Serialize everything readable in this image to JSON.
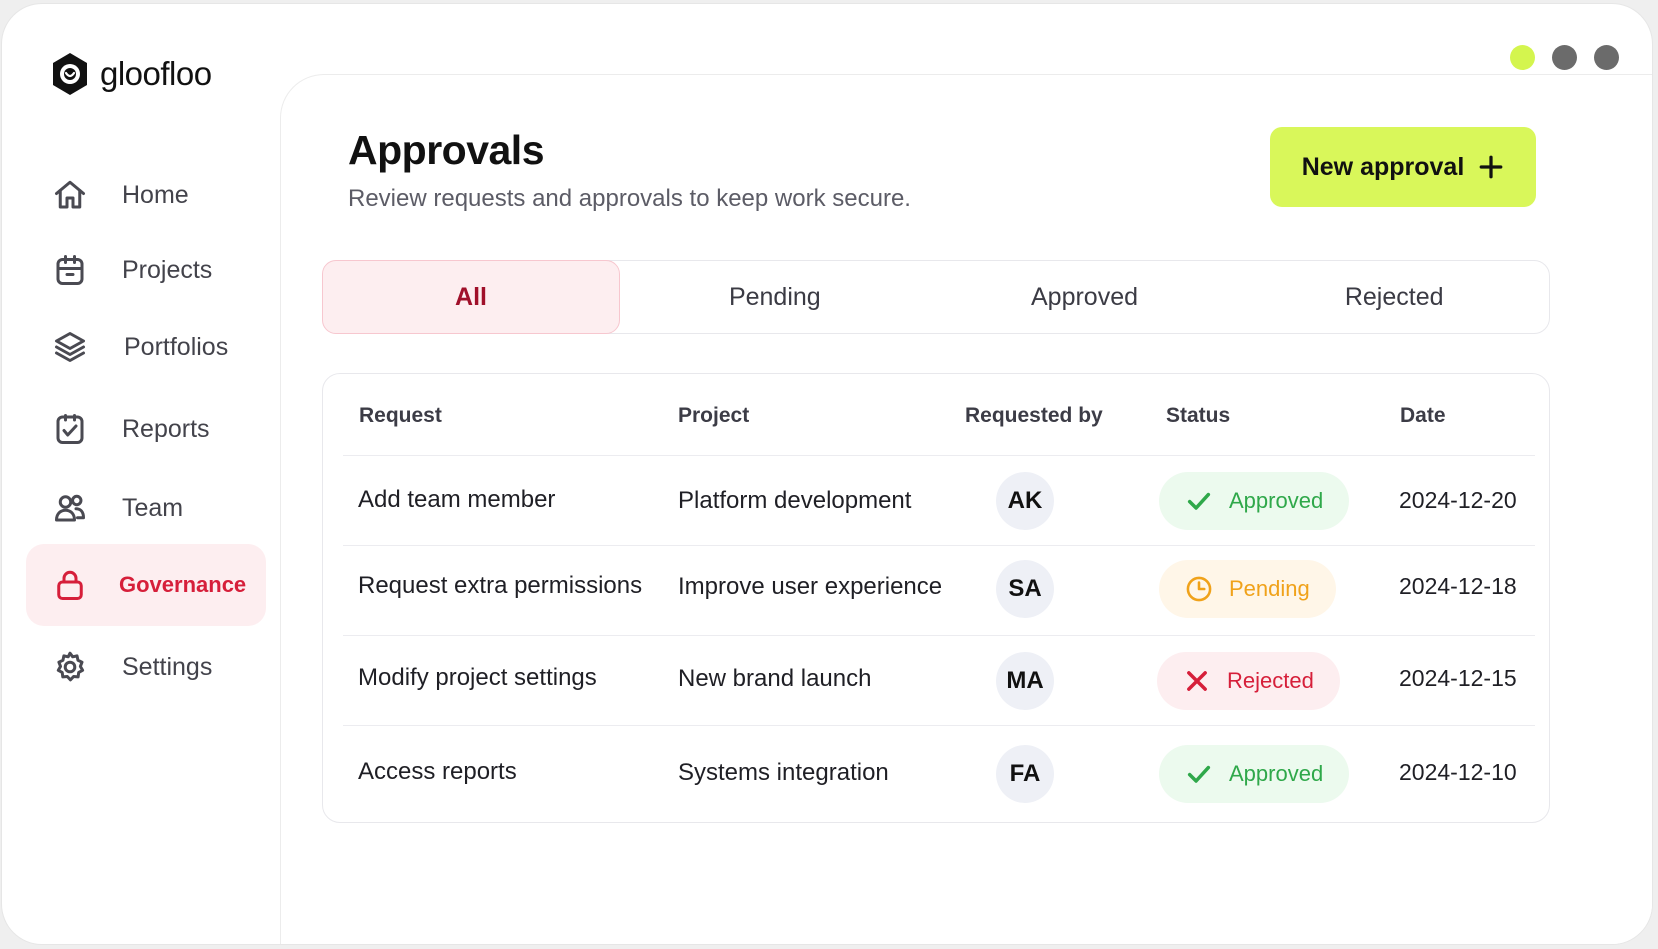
{
  "app": {
    "name": "gloofloo"
  },
  "window_dots": [
    "#d4f54e",
    "#6b6b6b",
    "#6b6b6b"
  ],
  "sidebar": {
    "items": [
      {
        "label": "Home",
        "icon": "home-icon",
        "active": false
      },
      {
        "label": "Projects",
        "icon": "clipboard-icon",
        "active": false
      },
      {
        "label": "Portfolios",
        "icon": "layers-icon",
        "active": false
      },
      {
        "label": "Reports",
        "icon": "report-chart-icon",
        "active": false
      },
      {
        "label": "Team",
        "icon": "users-icon",
        "active": false
      },
      {
        "label": "Governance",
        "icon": "lock-icon",
        "active": true
      },
      {
        "label": "Settings",
        "icon": "gear-icon",
        "active": false
      }
    ]
  },
  "header": {
    "title": "Approvals",
    "subtitle": "Review requests and approvals to keep work secure.",
    "new_button": "New approval"
  },
  "tabs": [
    {
      "label": "All",
      "active": true
    },
    {
      "label": "Pending",
      "active": false
    },
    {
      "label": "Approved",
      "active": false
    },
    {
      "label": "Rejected",
      "active": false
    }
  ],
  "table": {
    "columns": [
      "Request",
      "Project",
      "Requested by",
      "Status",
      "Date"
    ],
    "rows": [
      {
        "request": "Add team member",
        "project": "Platform development",
        "initials": "AK",
        "status": "Approved",
        "date": "2024-12-20"
      },
      {
        "request": "Request extra permissions",
        "project": "Improve user experience",
        "initials": "SA",
        "status": "Pending",
        "date": "2024-12-18"
      },
      {
        "request": "Modify project settings",
        "project": "New brand launch",
        "initials": "MA",
        "status": "Rejected",
        "date": "2024-12-15"
      },
      {
        "request": "Access reports",
        "project": "Systems integration",
        "initials": "FA",
        "status": "Approved",
        "date": "2024-12-10"
      }
    ]
  },
  "colors": {
    "accent": "#d9f75a",
    "active_red": "#d61f3a",
    "approved_text": "#2fa84a",
    "approved_bg": "#ecfaee",
    "pending_text": "#f0a21a",
    "pending_bg": "#fff6e8",
    "rejected_text": "#d61f3a",
    "rejected_bg": "#fdeef0"
  }
}
